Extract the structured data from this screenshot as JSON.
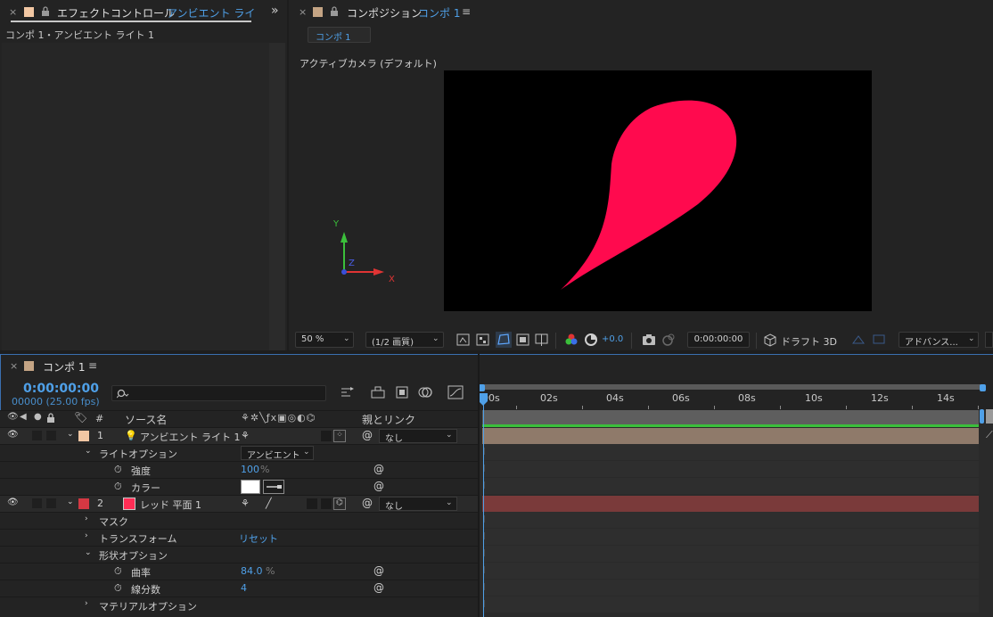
{
  "effects_panel": {
    "close_glyph": "×",
    "title_static": "エフェクトコントロール",
    "title_layer": "アンビエント ライ",
    "overflow_glyph": "»",
    "breadcrumb": "コンポ 1・アンビエント ライト 1",
    "swatch_color": "#f2c7a3"
  },
  "comp_panel": {
    "close_glyph": "×",
    "title_static": "コンポジション",
    "title_name": "コンポ 1",
    "menu_glyph": "≡",
    "chip_label": "コンポ 1",
    "camera_label": "アクティブカメラ (デフォルト)",
    "swatch_color": "#c4a484",
    "axis": {
      "y": "Y",
      "z": "Z",
      "x": "X"
    },
    "shape_color": "#ff0a4e"
  },
  "comp_toolbar": {
    "zoom": "50 %",
    "resolution": "(1/2 画質)",
    "exposure": "+0.0",
    "timecode": "0:00:00:00",
    "draft3d": "ドラフト 3D",
    "advanced": "アドバンス..."
  },
  "timeline": {
    "close_glyph": "×",
    "tab_label": "コンポ 1",
    "menu_glyph": "≡",
    "timecode": "0:00:00:00",
    "frame_info": "00000 (25.00 fps)",
    "search_icon": "search-icon",
    "columns": {
      "hash": "#",
      "source_name": "ソース名",
      "parent_link": "親とリンク"
    },
    "ruler": [
      "00s",
      "02s",
      "04s",
      "06s",
      "08s",
      "10s",
      "12s",
      "14s"
    ],
    "layers": [
      {
        "num": "1",
        "name": "アンビエント ライト 1",
        "label_color": "#f2c7a3",
        "parent": "なし",
        "track_color": "#8f7a6a"
      },
      {
        "num": "2",
        "name": "レッド 平面 1",
        "label_color": "#d43843",
        "swatch_color": "#ff2d55",
        "parent": "なし",
        "track_color": "#7a3a3a"
      }
    ],
    "props": {
      "light_options": "ライトオプション",
      "light_options_value": "アンビエント",
      "intensity": "強度",
      "intensity_value": "100",
      "intensity_unit": "%",
      "color": "カラー",
      "mask": "マスク",
      "transform": "トランスフォーム",
      "reset": "リセット",
      "shape_options": "形状オプション",
      "curvature": "曲率",
      "curvature_value": "84.0",
      "curvature_unit": "%",
      "segments": "線分数",
      "segments_value": "4",
      "material_options": "マテリアルオプション"
    }
  }
}
